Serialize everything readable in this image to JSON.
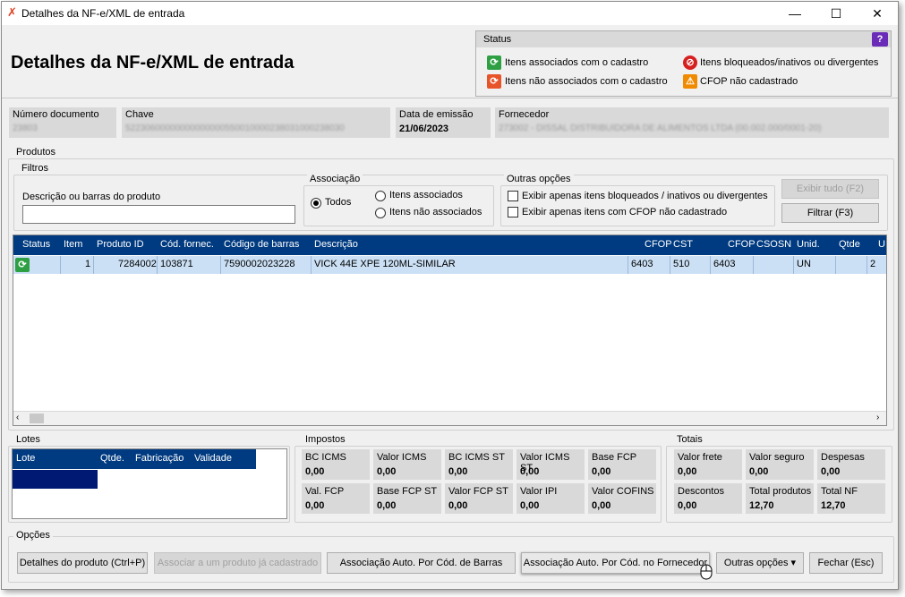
{
  "window": {
    "title": "Detalhes da NF-e/XML de entrada",
    "controls": {
      "minimize": "—",
      "maximize": "☐",
      "close": "✕"
    }
  },
  "page_title": "Detalhes da NF-e/XML de entrada",
  "status_legend": {
    "title": "Status",
    "help": "?",
    "items": [
      {
        "label": "Itens associados com o cadastro",
        "icon": "sync-green-icon",
        "color": "#2ea043"
      },
      {
        "label": "Itens não associados com o cadastro",
        "icon": "sync-orange-icon",
        "color": "#e8542a"
      },
      {
        "label": "Itens bloqueados/inativos ou divergentes",
        "icon": "blocked-red-icon",
        "color": "#d61f1f"
      },
      {
        "label": "CFOP não cadastrado",
        "icon": "warning-orange-icon",
        "color": "#f08a00"
      }
    ]
  },
  "invoice": {
    "numero_label": "Número documento",
    "numero_value": "23803",
    "chave_label": "Chave",
    "chave_value": "52230600000000000000550010000238031000238030",
    "data_label": "Data de emissão",
    "data_value": "21/06/2023",
    "fornecedor_label": "Fornecedor",
    "fornecedor_value": "273002 - DISSAL DISTRIBUIDORA DE ALIMENTOS LTDA (00.002.000/0001-20)"
  },
  "produtos": {
    "section_label": "Produtos",
    "filtros_label": "Filtros",
    "search_label": "Descrição ou barras do produto",
    "search_value": "",
    "associacao_label": "Associação",
    "radio_todos": "Todos",
    "radio_associados": "Itens associados",
    "radio_nao_associados": "Itens não associados",
    "outras_label": "Outras opções",
    "check_bloqueados": "Exibir apenas itens bloqueados / inativos ou divergentes",
    "check_cfop": "Exibir apenas itens com CFOP não cadastrado",
    "btn_exibir": "Exibir tudo (F2)",
    "btn_filtrar": "Filtrar (F3)"
  },
  "grid": {
    "columns": [
      "Status",
      "Item",
      "Produto ID",
      "Cód. fornec.",
      "Código de barras",
      "Descrição",
      "CFOP",
      "CST",
      "CFOP",
      "CSOSN",
      "Unid.",
      "Qtde",
      "U"
    ],
    "rows": [
      {
        "status_icon": "sync-green-icon",
        "item": "1",
        "produto_id": "7284002",
        "cod_fornec": "103871",
        "barras": "7590002023228",
        "descricao": "VICK 44E XPE 120ML-SIMILAR",
        "cfop": "6403",
        "cst": "510",
        "cfop2": "6403",
        "csosn": "",
        "unid": "UN",
        "qtde": "",
        "u": "2"
      }
    ]
  },
  "lotes": {
    "label": "Lotes",
    "columns": [
      "Lote",
      "Qtde.",
      "Fabricação",
      "Validade"
    ]
  },
  "impostos": {
    "label": "Impostos",
    "cards": [
      {
        "label": "BC ICMS",
        "value": "0,00"
      },
      {
        "label": "Valor ICMS",
        "value": "0,00"
      },
      {
        "label": "BC ICMS ST",
        "value": "0,00"
      },
      {
        "label": "Valor ICMS ST",
        "value": "0,00"
      },
      {
        "label": "Base FCP",
        "value": "0,00"
      },
      {
        "label": "Val. FCP",
        "value": "0,00"
      },
      {
        "label": "Base FCP ST",
        "value": "0,00"
      },
      {
        "label": "Valor FCP ST",
        "value": "0,00"
      },
      {
        "label": "Valor IPI",
        "value": "0,00"
      },
      {
        "label": "Valor COFINS",
        "value": "0,00"
      }
    ]
  },
  "totais": {
    "label": "Totais",
    "cards": [
      {
        "label": "Valor frete",
        "value": "0,00"
      },
      {
        "label": "Valor seguro",
        "value": "0,00"
      },
      {
        "label": "Despesas",
        "value": "0,00"
      },
      {
        "label": "Descontos",
        "value": "0,00"
      },
      {
        "label": "Total produtos",
        "value": "12,70"
      },
      {
        "label": "Total NF",
        "value": "12,70"
      }
    ]
  },
  "opcoes": {
    "label": "Opções",
    "btn_detalhes": "Detalhes do produto (Ctrl+P)",
    "btn_associar": "Associar a um produto já cadastrado",
    "btn_auto_barras": "Associação Auto. Por Cód. de Barras",
    "btn_auto_fornecedor": "Associação Auto. Por Cód. no Fornecedor",
    "btn_outras": "Outras opções",
    "btn_fechar": "Fechar (Esc)"
  }
}
